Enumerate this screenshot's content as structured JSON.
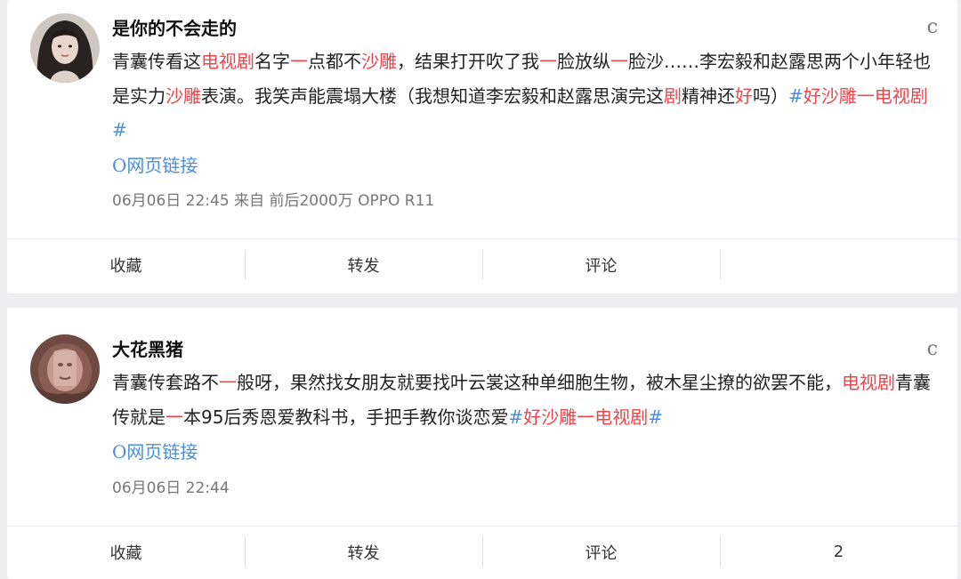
{
  "posts": [
    {
      "username": "是你的不会走的",
      "more_glyph": "c",
      "content": [
        {
          "t": "青囊传看这"
        },
        {
          "t": "电视剧",
          "s": "hl"
        },
        {
          "t": "名字"
        },
        {
          "t": "一",
          "s": "hl"
        },
        {
          "t": "点都不"
        },
        {
          "t": "沙雕",
          "s": "hl"
        },
        {
          "t": "，结果打开吹了我"
        },
        {
          "t": "一",
          "s": "hl"
        },
        {
          "t": "脸放纵"
        },
        {
          "t": "一",
          "s": "hl"
        },
        {
          "t": "脸沙……李宏毅和赵露思两个小年轻也是实力"
        },
        {
          "t": "沙雕",
          "s": "hl"
        },
        {
          "t": "表演。我笑声能震塌大楼（我想知道李宏毅和赵露思演完这"
        },
        {
          "t": "剧",
          "s": "hl"
        },
        {
          "t": "精神还"
        },
        {
          "t": "好",
          "s": "hl"
        },
        {
          "t": "吗）"
        },
        {
          "t": "#",
          "s": "tag"
        },
        {
          "t": "好沙雕一电视剧",
          "s": "hl"
        },
        {
          "t": "#",
          "s": "tag"
        }
      ],
      "link_icon": "O",
      "link_text": "网页链接",
      "meta": "06月06日 22:45 来自 前后2000万 OPPO R11",
      "actions": [
        "收藏",
        "转发",
        "评论",
        ""
      ]
    },
    {
      "username": "大花黑猪",
      "more_glyph": "c",
      "content": [
        {
          "t": "青囊传套路不"
        },
        {
          "t": "一",
          "s": "hl"
        },
        {
          "t": "般呀，果然找女朋友就要找叶云裳这种单细胞生物，被木星尘撩的欲罢不能，"
        },
        {
          "t": "电视剧",
          "s": "hl"
        },
        {
          "t": "青囊传就是"
        },
        {
          "t": "一",
          "s": "hl"
        },
        {
          "t": "本95后秀恩爱教科书，手把手教你谈恋爱"
        },
        {
          "t": "#",
          "s": "tag"
        },
        {
          "t": "好沙雕一电视剧",
          "s": "hl"
        },
        {
          "t": "#",
          "s": "tag"
        }
      ],
      "link_icon": "O",
      "link_text": "网页链接",
      "meta": "06月06日 22:44",
      "actions": [
        "收藏",
        "转发",
        "评论",
        "2"
      ]
    }
  ],
  "colors": {
    "highlight": "#e8474d",
    "tag": "#4a8fd6",
    "meta": "#777777",
    "background": "#eeeef0"
  }
}
